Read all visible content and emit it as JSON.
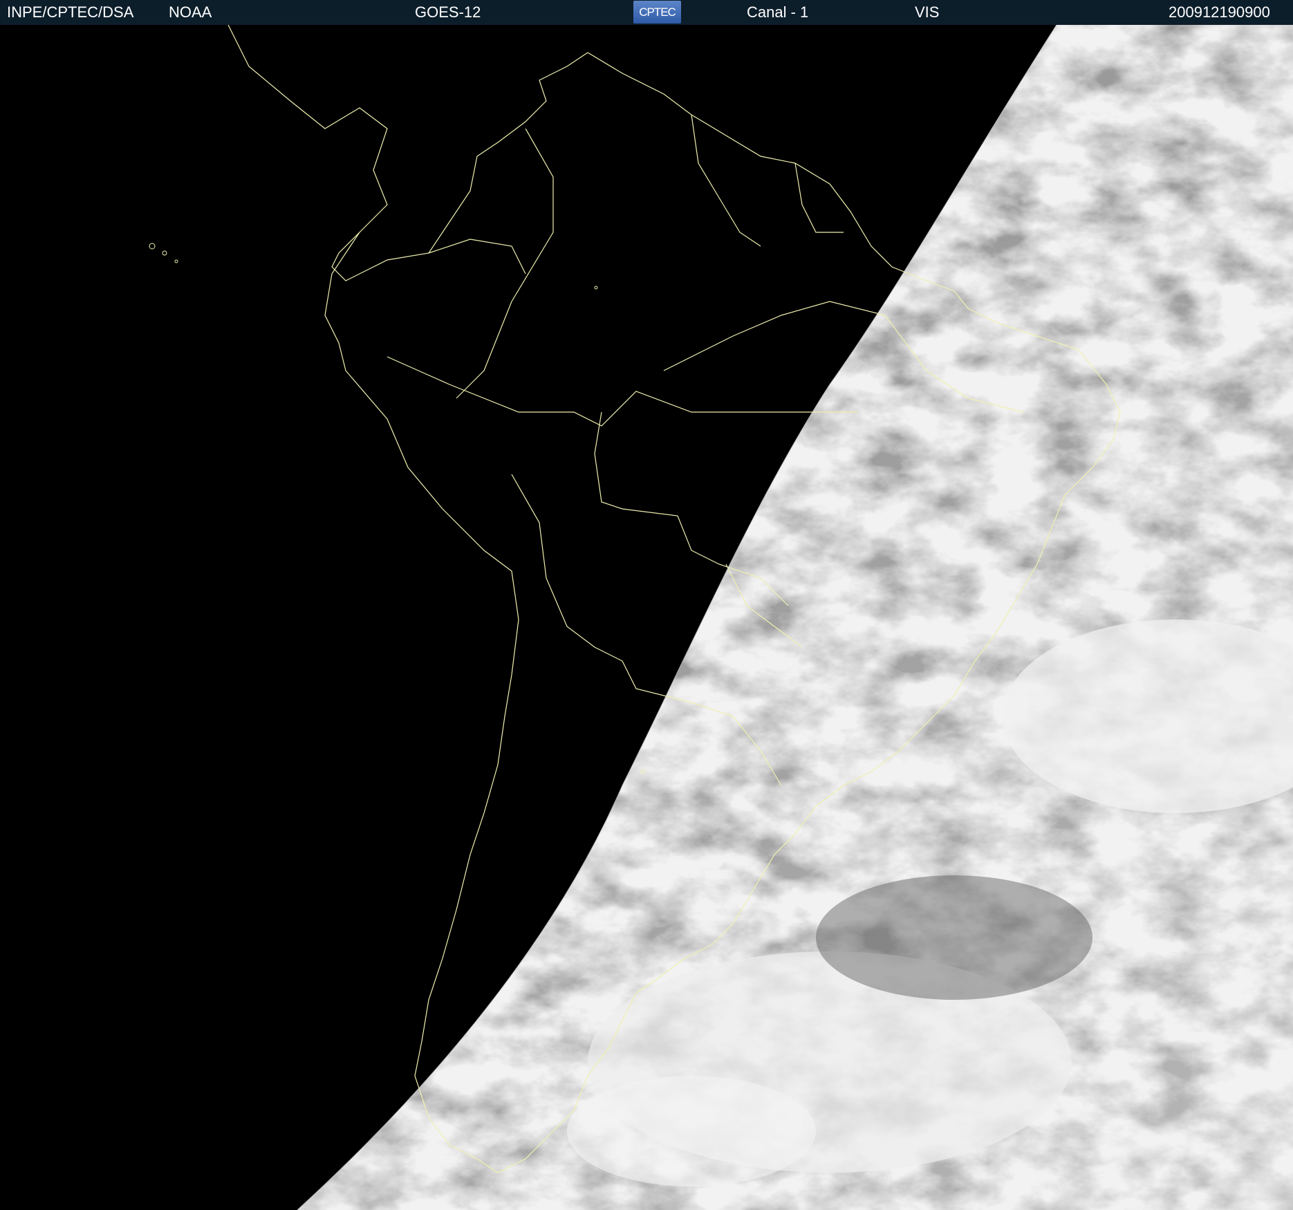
{
  "header": {
    "org": "INPE/CPTEC/DSA",
    "agency": "NOAA",
    "satellite": "GOES-12",
    "logo_text": "CPTEC",
    "channel": "Canal - 1",
    "band": "VIS",
    "timestamp": "200912190900"
  },
  "colors": {
    "header_bg": "#0d1e2b",
    "space": "#000000",
    "coastline": "#f0f0b0",
    "cloud": "#e9e9e9",
    "ocean": "#7a7a7a"
  },
  "map": {
    "icons": [
      "cptec-logo-icon",
      "coastline-overlay",
      "terminator-line"
    ]
  }
}
